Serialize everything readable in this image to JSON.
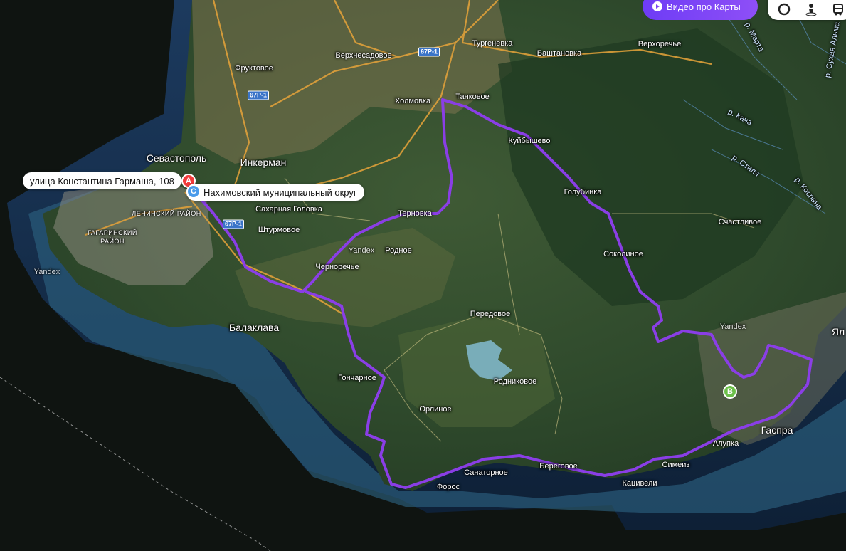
{
  "toolbar": {
    "video_button_label": "Видео про Карты",
    "tools": [
      {
        "icon": "layers-ring-icon"
      },
      {
        "icon": "panorama-person-icon"
      },
      {
        "icon": "transport-bus-icon"
      }
    ]
  },
  "route_points": [
    {
      "letter": "A",
      "color": "#f23c3c",
      "label": "улица Константина Гармаша, 108"
    },
    {
      "letter": "C",
      "color": "#4b9bea",
      "label": "Нахимовский муниципальный округ"
    },
    {
      "letter": "B",
      "color": "#6cc04a",
      "label": ""
    }
  ],
  "route_color": "#8a3ee6",
  "places": {
    "sevastopol": "Севастополь",
    "inkerman": "Инкерман",
    "balaklava": "Балаклава",
    "gaspra": "Гаспра",
    "yalta_partial": "Ял",
    "fruktovoe": "Фруктовое",
    "verkhnesadovoe": "Верхнесадовое",
    "turgenevka": "Тургеневка",
    "bashtanovka": "Баштановка",
    "verkhorechye": "Верхоречье",
    "kholmovka": "Холмовка",
    "tankovoe": "Танковое",
    "kuibyshevo": "Куйбышево",
    "golubinka": "Голубинка",
    "schastlivoe": "Счастливое",
    "sokolinoe": "Соколиное",
    "sakharnaya_golovka": "Сахарная Головка",
    "shturmovoe": "Штурмовое",
    "rodnoe": "Родное",
    "chernorechye": "Черноречье",
    "ternovka": "Терновка",
    "peredovoe": "Передовое",
    "rodnikovoe": "Родниковое",
    "goncharnoe": "Гончарное",
    "orlinoe": "Орлиное",
    "foros": "Форос",
    "sanatornoe": "Санаторное",
    "beregovoe": "Береговое",
    "katsiveli": "Кацивели",
    "simeiz": "Симеиз",
    "alupka": "Алупка",
    "leninsky": "ЛЕНИНСКИЙ РАЙОН",
    "gagarinsky_1": "ГАГАРИНСКИЙ",
    "gagarinsky_2": "РАЙОН"
  },
  "rivers": {
    "marta": "р. Марта",
    "sukhaya_alma": "р. Сухая Альма",
    "kacha": "р. Кача",
    "stilya": "р. Стиля",
    "kospana": "р. Коспана"
  },
  "road_badges": [
    "67Р-1",
    "67Р-1",
    "67Р-1"
  ],
  "watermark": "Yandex"
}
